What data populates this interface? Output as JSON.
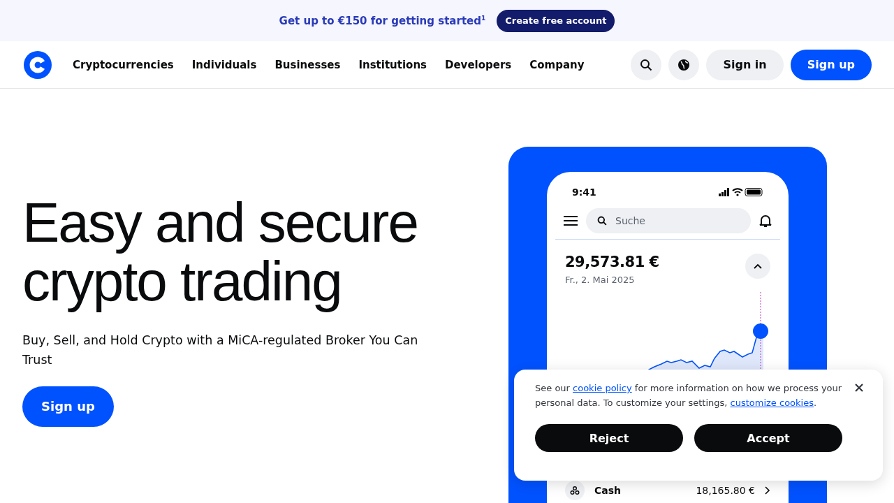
{
  "promo_bar": {
    "text": "Get up to €150 for getting started$^{1}$",
    "button": "Create free account"
  },
  "nav": {
    "items": [
      "Cryptocurrencies",
      "Individuals",
      "Businesses",
      "Institutions",
      "Developers",
      "Company"
    ],
    "sign_in": "Sign in",
    "sign_up": "Sign up"
  },
  "hero": {
    "title": "Easy and secure crypto trading",
    "subtitle": "Buy, Sell, and Hold Crypto with a MiCA-regulated Broker You Can Trust",
    "button": "Sign up"
  },
  "phone": {
    "time": "9:41",
    "search_placeholder": "Suche",
    "balance": "29,573.81 €",
    "date": "Fr., 2. Mai 2025",
    "cash_label": "Cash",
    "cash_value": "18,165.80 €"
  },
  "cookie_banner": {
    "text_before": "See our ",
    "policy_link": "cookie policy",
    "text_middle": " for more information on how we process your personal data. To customize your settings, ",
    "customize_link": "customize cookies",
    "text_after": ".",
    "reject": "Reject",
    "accept": "Accept"
  }
}
